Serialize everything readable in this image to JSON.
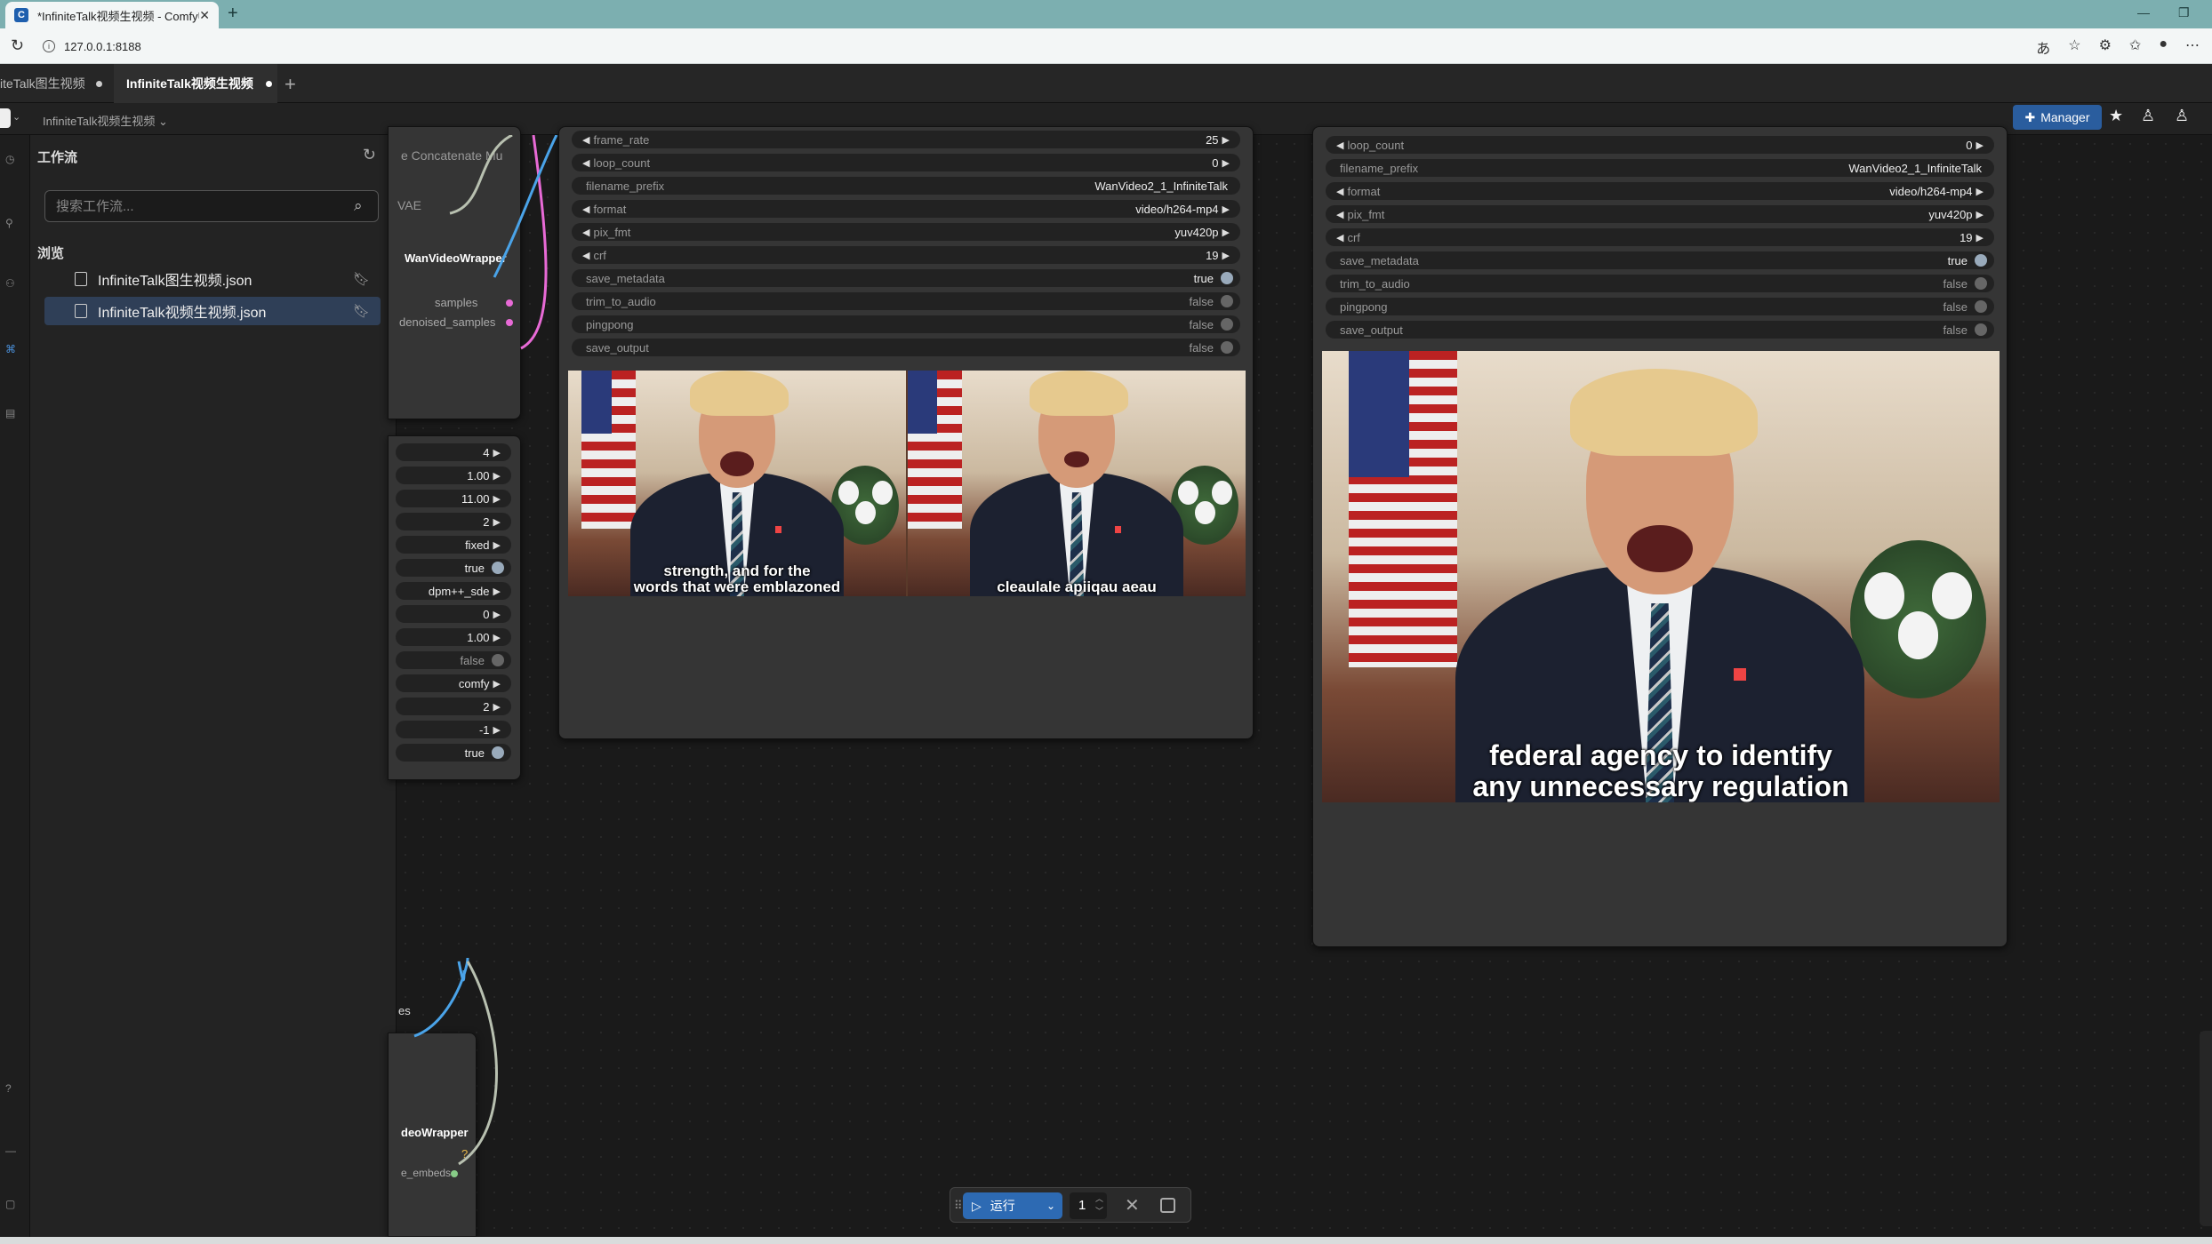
{
  "browser": {
    "tab_title": "*InfiniteTalk视频生视频 - ComfyUI",
    "url": "127.0.0.1:8188"
  },
  "workflow_tabs": [
    {
      "label": "iteTalk图生视频"
    },
    {
      "label": "InfiniteTalk视频生视频"
    }
  ],
  "breadcrumb": "InfiniteTalk视频生视频",
  "manager_label": "Manager",
  "sidebar": {
    "title": "工作流",
    "search_placeholder": "搜索工作流...",
    "browse_label": "浏览",
    "items": [
      {
        "label": "InfiniteTalk图生视频.json",
        "selected": false
      },
      {
        "label": "InfiniteTalk视频生视频.json",
        "selected": true
      }
    ]
  },
  "partial_node": {
    "top_label": "e Concatenate Mu",
    "vae_label": "VAE",
    "wrapper_label": "WanVideoWrapper",
    "outputs": [
      "samples",
      "denoised_samples"
    ],
    "values": [
      "4",
      "1.00",
      "11.00",
      "2",
      "fixed",
      "true",
      "dpm++_sde",
      "0",
      "1.00",
      "false",
      "comfy",
      "2",
      "-1",
      "true"
    ],
    "bottom_slot_label": "es",
    "bottom_node_title": "deoWrapper",
    "bottom_node_badge": "?",
    "bottom_node_output": "e_embeds"
  },
  "combine_left": {
    "widgets": [
      {
        "name": "frame_rate",
        "value": "25",
        "kind": "num"
      },
      {
        "name": "loop_count",
        "value": "0",
        "kind": "num"
      },
      {
        "name": "filename_prefix",
        "value": "WanVideo2_1_InfiniteTalk",
        "kind": "text"
      },
      {
        "name": "format",
        "value": "video/h264-mp4",
        "kind": "num"
      },
      {
        "name": "pix_fmt",
        "value": "yuv420p",
        "kind": "num"
      },
      {
        "name": "crf",
        "value": "19",
        "kind": "num"
      },
      {
        "name": "save_metadata",
        "value": "true",
        "kind": "bool"
      },
      {
        "name": "trim_to_audio",
        "value": "false",
        "kind": "bool"
      },
      {
        "name": "pingpong",
        "value": "false",
        "kind": "bool"
      },
      {
        "name": "save_output",
        "value": "false",
        "kind": "bool"
      }
    ],
    "subtitle_left": "strength, and for the\nwords that were emblazoned",
    "subtitle_right": "cleaulale apiiqau aeau"
  },
  "combine_right": {
    "widgets": [
      {
        "name": "loop_count",
        "value": "0",
        "kind": "num"
      },
      {
        "name": "filename_prefix",
        "value": "WanVideo2_1_InfiniteTalk",
        "kind": "text"
      },
      {
        "name": "format",
        "value": "video/h264-mp4",
        "kind": "num"
      },
      {
        "name": "pix_fmt",
        "value": "yuv420p",
        "kind": "num"
      },
      {
        "name": "crf",
        "value": "19",
        "kind": "num"
      },
      {
        "name": "save_metadata",
        "value": "true",
        "kind": "bool"
      },
      {
        "name": "trim_to_audio",
        "value": "false",
        "kind": "bool"
      },
      {
        "name": "pingpong",
        "value": "false",
        "kind": "bool"
      },
      {
        "name": "save_output",
        "value": "false",
        "kind": "bool"
      }
    ],
    "subtitle": "federal agency to identify\nany unnecessary regulation"
  },
  "runbar": {
    "run_label": "运行",
    "count": "1"
  },
  "colors": {
    "accent": "#2d6ab3",
    "manager": "#2a5d9e",
    "link_blue": "#4aa3e8",
    "link_pink": "#e86ad6",
    "link_gray": "#b8c0b0"
  }
}
